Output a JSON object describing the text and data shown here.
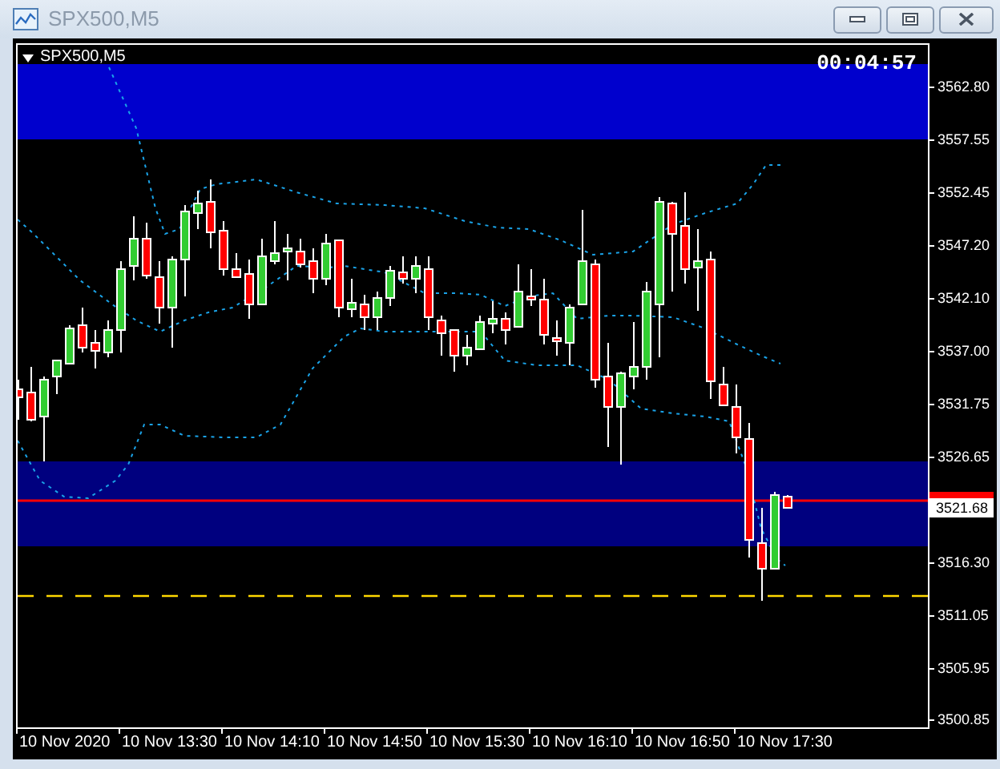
{
  "window": {
    "title": "SPX500,M5"
  },
  "chart": {
    "symbol_label": "SPX500,M5",
    "countdown": "00:04:57",
    "current_price": "3521.68",
    "price_axis": [
      "3562.80",
      "3557.55",
      "3552.45",
      "3547.20",
      "3542.10",
      "3537.00",
      "3531.75",
      "3526.65",
      "3516.30",
      "3511.05",
      "3505.95",
      "3500.85"
    ],
    "time_axis": [
      "10 Nov 2020",
      "10 Nov 13:30",
      "10 Nov 14:10",
      "10 Nov 14:50",
      "10 Nov 15:30",
      "10 Nov 16:10",
      "10 Nov 16:50",
      "10 Nov 17:30"
    ]
  }
}
